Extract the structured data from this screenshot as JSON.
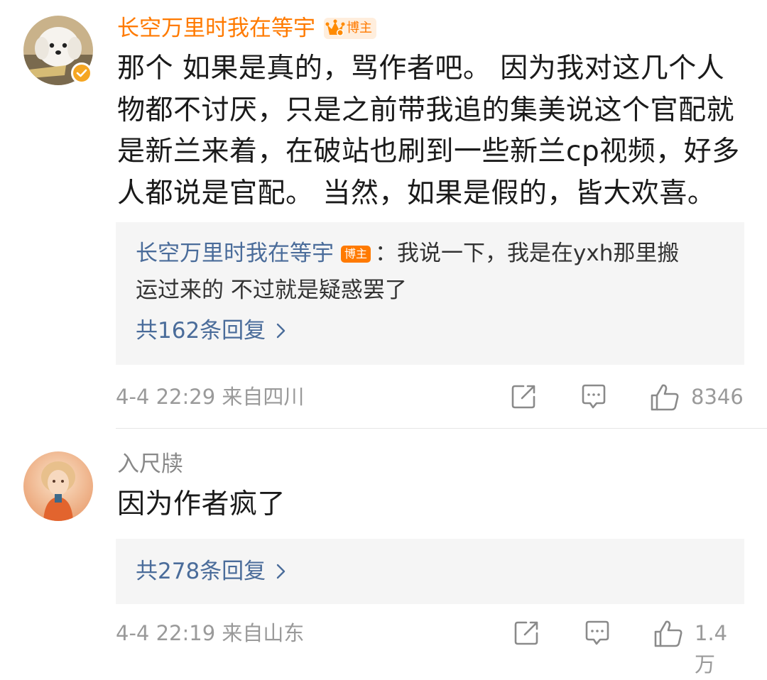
{
  "comments": [
    {
      "username": "长空万里时我在等宇",
      "tag": "博主",
      "body": "那个 如果是真的，骂作者吧。 因为我对这几个人物都不讨厌，只是之前带我追的集美说这个官配就是新兰来着，在破站也刷到一些新兰cp视频，好多人都说是官配。 当然，如果是假的，皆大欢喜。",
      "reply": {
        "author": "长空万里时我在等宇",
        "tag": "博主",
        "text_line1": "：我说一下，我是在yxh那里搬",
        "text_line2": "运过来的 不过就是疑惑罢了"
      },
      "reply_count": "共162条回复",
      "meta": "4-4 22:29  来自四川",
      "likes": "8346"
    },
    {
      "username": "入尺牍",
      "body": "因为作者疯了",
      "reply_count": "共278条回复",
      "meta": "4-4 22:19  来自山东",
      "likes": "1.4万"
    }
  ],
  "colors": {
    "vip_name": "#ff7a00",
    "link_blue": "#4a6c9a",
    "meta_gray": "#9a9a9a",
    "body_text": "#1a1a1a",
    "reply_bg": "#f5f5f5"
  },
  "icons": {
    "share": "share-icon",
    "comment": "comment-icon",
    "like": "thumbs-up-icon",
    "chevron": "chevron-right-icon",
    "crown": "crown-icon",
    "verified": "verified-badge-icon"
  }
}
